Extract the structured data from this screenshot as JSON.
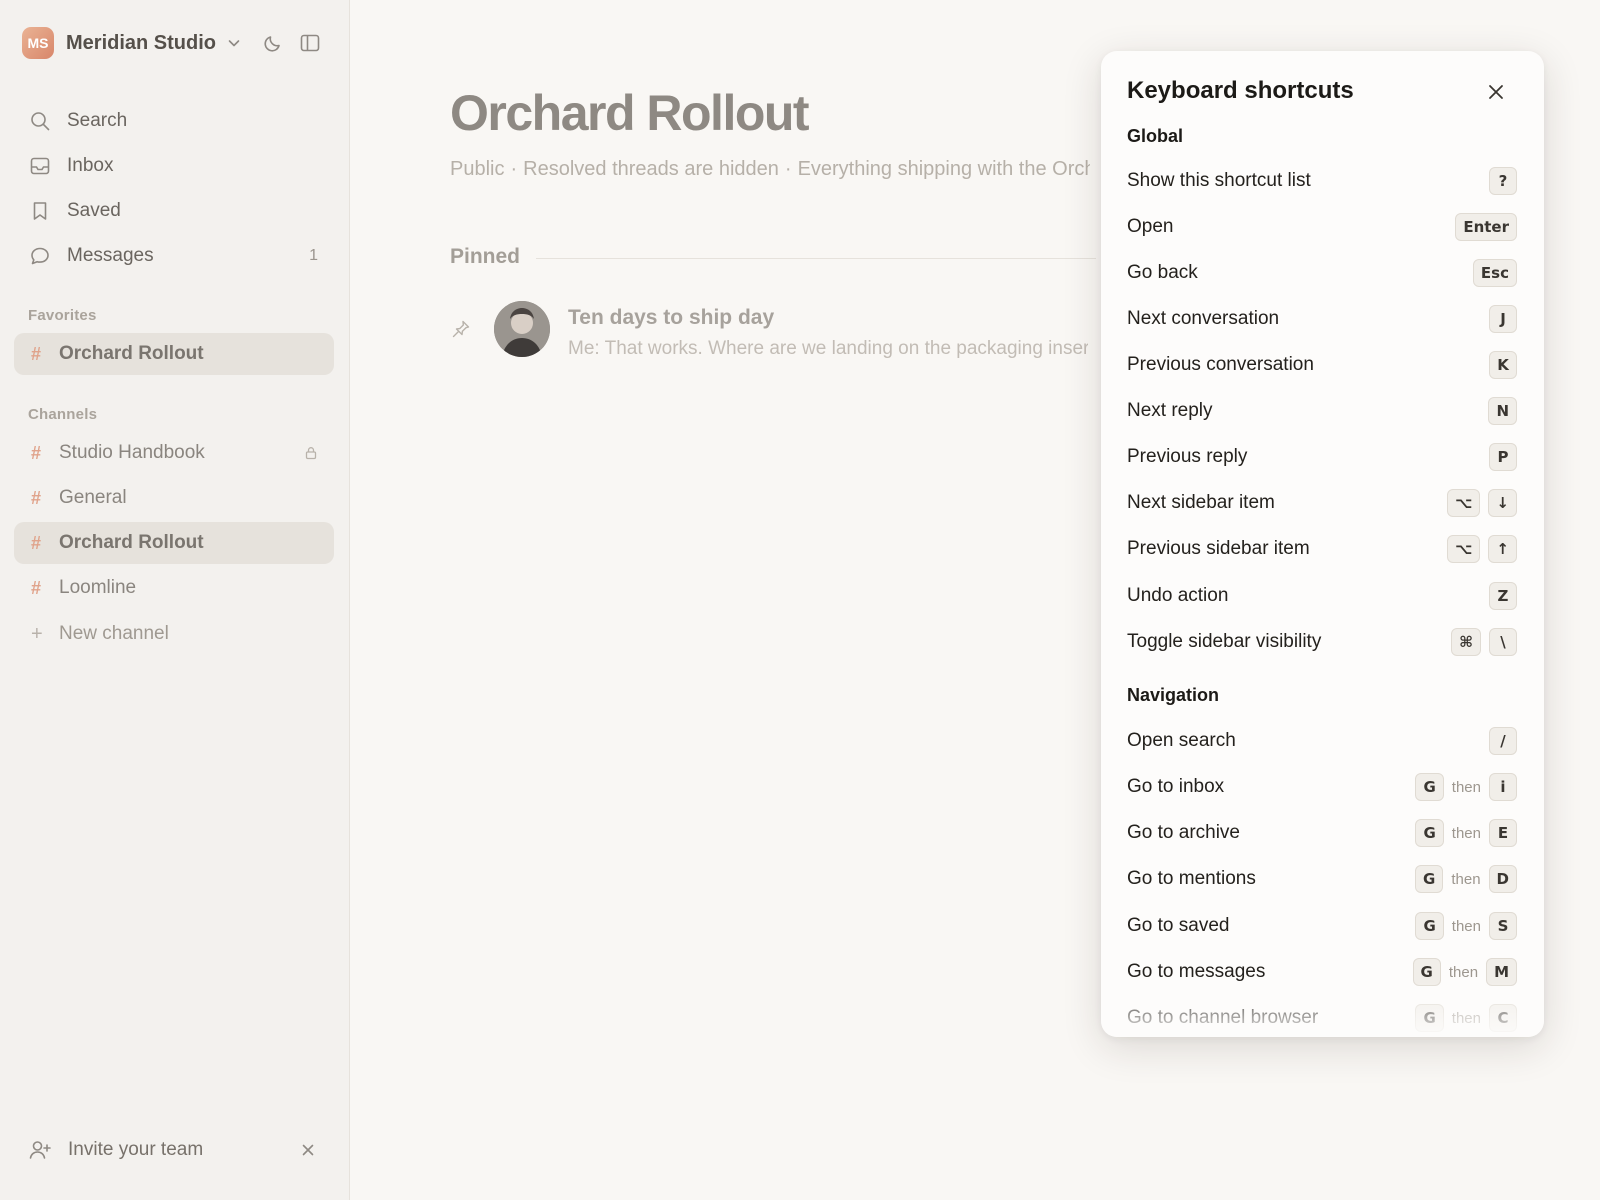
{
  "sidebar": {
    "workspace": {
      "initials": "MS",
      "name": "Meridian Studio"
    },
    "nav": [
      {
        "label": "Search",
        "icon": "search-icon"
      },
      {
        "label": "Inbox",
        "icon": "inbox-icon"
      },
      {
        "label": "Saved",
        "icon": "bookmark-icon"
      },
      {
        "label": "Messages",
        "icon": "chat-bubble-icon",
        "count": "1"
      }
    ],
    "favorites_title": "Favorites",
    "favorites": [
      {
        "label": "Orchard Rollout",
        "active": true
      }
    ],
    "channels_title": "Channels",
    "channels": [
      {
        "label": "Studio Handbook",
        "locked": true
      },
      {
        "label": "General"
      },
      {
        "label": "Orchard Rollout",
        "active": true
      },
      {
        "label": "Loomline"
      }
    ],
    "new_channel": "New channel",
    "invite": "Invite your team"
  },
  "main": {
    "title": "Orchard Rollout",
    "meta": [
      "Public",
      "Resolved threads are hidden",
      "Everything shipping with the Orch"
    ],
    "pinned_label": "Pinned",
    "pinned": {
      "title": "Ten days to ship day",
      "preview": "Me: That works. Where are we landing on the packaging inser"
    }
  },
  "shortcuts": {
    "title": "Keyboard shortcuts",
    "then": "then",
    "groups": [
      {
        "title": "Global",
        "items": [
          {
            "label": "Show this shortcut list",
            "keys": [
              "?"
            ]
          },
          {
            "label": "Open",
            "keys": [
              "Enter"
            ]
          },
          {
            "label": "Go back",
            "keys": [
              "Esc"
            ]
          },
          {
            "label": "Next conversation",
            "keys": [
              "J"
            ]
          },
          {
            "label": "Previous conversation",
            "keys": [
              "K"
            ]
          },
          {
            "label": "Next reply",
            "keys": [
              "N"
            ]
          },
          {
            "label": "Previous reply",
            "keys": [
              "P"
            ]
          },
          {
            "label": "Next sidebar item",
            "keys": [
              "⌥",
              "↓"
            ]
          },
          {
            "label": "Previous sidebar item",
            "keys": [
              "⌥",
              "↑"
            ]
          },
          {
            "label": "Undo action",
            "keys": [
              "Z"
            ]
          },
          {
            "label": "Toggle sidebar visibility",
            "keys": [
              "⌘",
              "\\"
            ]
          }
        ]
      },
      {
        "title": "Navigation",
        "items": [
          {
            "label": "Open search",
            "keys": [
              "/"
            ]
          },
          {
            "label": "Go to inbox",
            "keys": [
              "G",
              "i"
            ],
            "sequence": true
          },
          {
            "label": "Go to archive",
            "keys": [
              "G",
              "E"
            ],
            "sequence": true
          },
          {
            "label": "Go to mentions",
            "keys": [
              "G",
              "D"
            ],
            "sequence": true
          },
          {
            "label": "Go to saved",
            "keys": [
              "G",
              "S"
            ],
            "sequence": true
          },
          {
            "label": "Go to messages",
            "keys": [
              "G",
              "M"
            ],
            "sequence": true
          },
          {
            "label": "Go to channel browser",
            "keys": [
              "G",
              "C"
            ],
            "sequence": true
          }
        ]
      }
    ]
  },
  "colors": {
    "accent": "#e0a38b",
    "avatar": "#d8866a",
    "background": "#f9f7f4",
    "sidebar": "#f3f1ee"
  }
}
